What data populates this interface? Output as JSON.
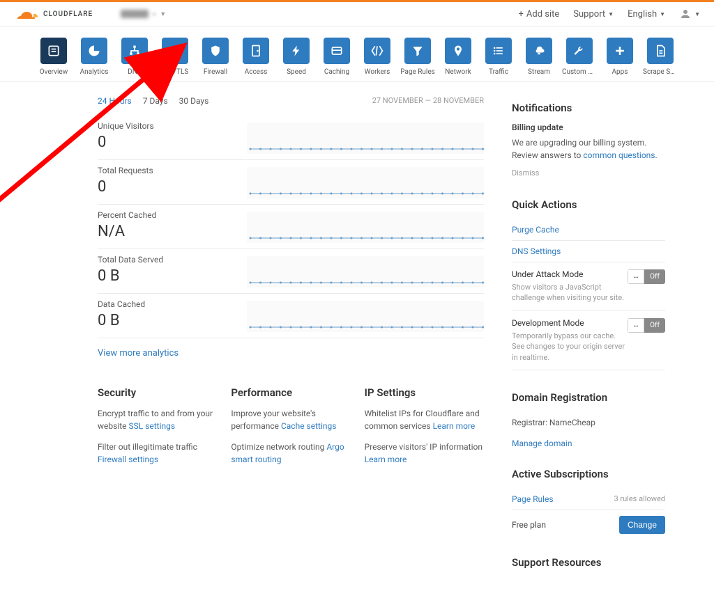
{
  "header": {
    "brand": "CLOUDFLARE",
    "add_site": "Add site",
    "support": "Support",
    "language": "English"
  },
  "nav": [
    {
      "label": "Overview",
      "icon": "overview"
    },
    {
      "label": "Analytics",
      "icon": "analytics"
    },
    {
      "label": "DNS",
      "icon": "dns"
    },
    {
      "label": "SSL/TLS",
      "icon": "lock"
    },
    {
      "label": "Firewall",
      "icon": "shield"
    },
    {
      "label": "Access",
      "icon": "door"
    },
    {
      "label": "Speed",
      "icon": "bolt"
    },
    {
      "label": "Caching",
      "icon": "cache"
    },
    {
      "label": "Workers",
      "icon": "workers"
    },
    {
      "label": "Page Rules",
      "icon": "funnel"
    },
    {
      "label": "Network",
      "icon": "pin"
    },
    {
      "label": "Traffic",
      "icon": "list"
    },
    {
      "label": "Stream",
      "icon": "cloud"
    },
    {
      "label": "Custom Pa...",
      "icon": "wrench"
    },
    {
      "label": "Apps",
      "icon": "plus"
    },
    {
      "label": "Scrape Shi...",
      "icon": "page"
    }
  ],
  "time_tabs": [
    "24 Hours",
    "7 Days",
    "30 Days"
  ],
  "date_range": "27 NOVEMBER — 28 NOVEMBER",
  "stats": [
    {
      "label": "Unique Visitors",
      "value": "0"
    },
    {
      "label": "Total Requests",
      "value": "0"
    },
    {
      "label": "Percent Cached",
      "value": "N/A"
    },
    {
      "label": "Total Data Served",
      "value": "0 B"
    },
    {
      "label": "Data Cached",
      "value": "0 B"
    }
  ],
  "view_more": "View more analytics",
  "cards": {
    "security": {
      "title": "Security",
      "p1": "Encrypt traffic to and from your website ",
      "l1": "SSL settings",
      "p2": "Filter out illegitimate traffic ",
      "l2": "Firewall settings"
    },
    "performance": {
      "title": "Performance",
      "p1": "Improve your website's performance ",
      "l1": "Cache settings",
      "p2": "Optimize network routing ",
      "l2": "Argo smart routing"
    },
    "ip": {
      "title": "IP Settings",
      "p1": "Whitelist IPs for Cloudflare and common services ",
      "l1": "Learn more",
      "p2": "Preserve visitors' IP information ",
      "l2": "Learn more"
    }
  },
  "sidebar": {
    "notifications": {
      "title": "Notifications",
      "item_title": "Billing update",
      "body1": "We are upgrading our billing system. Review answers to ",
      "link": "common questions",
      "body2": ".",
      "dismiss": "Dismiss"
    },
    "quick_actions": {
      "title": "Quick Actions",
      "purge": "Purge Cache",
      "dns": "DNS Settings",
      "attack": {
        "title": "Under Attack Mode",
        "desc": "Show visitors a JavaScript challenge when visiting your site.",
        "state": "Off"
      },
      "dev": {
        "title": "Development Mode",
        "desc": "Temporarily bypass our cache. See changes to your origin server in realtime.",
        "state": "Off"
      }
    },
    "domain": {
      "title": "Domain Registration",
      "registrar_label": "Registrar: ",
      "registrar": "NameCheap",
      "manage": "Manage domain"
    },
    "subs": {
      "title": "Active Subscriptions",
      "page_rules": "Page Rules",
      "allowed": "3 rules allowed",
      "plan": "Free plan",
      "change": "Change"
    },
    "support": {
      "title": "Support Resources"
    }
  }
}
